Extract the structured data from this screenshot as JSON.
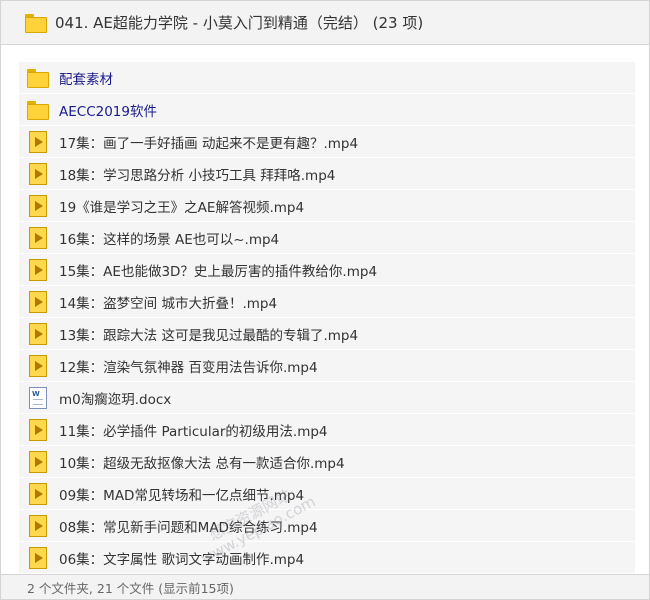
{
  "header": {
    "title": "041. AE超能力学院 - 小莫入门到精通（完结） (23 项)"
  },
  "items": [
    {
      "type": "folder",
      "label": "配套素材"
    },
    {
      "type": "folder",
      "label": "AECC2019软件"
    },
    {
      "type": "media",
      "label": "17集：画了一手好插画 动起来不是更有趣？.mp4"
    },
    {
      "type": "media",
      "label": "18集：学习思路分析 小技巧工具 拜拜咯.mp4"
    },
    {
      "type": "media",
      "label": "19《谁是学习之王》之AE解答视频.mp4"
    },
    {
      "type": "media",
      "label": "16集：这样的场景 AE也可以~.mp4"
    },
    {
      "type": "media",
      "label": "15集：AE也能做3D？史上最厉害的插件教给你.mp4"
    },
    {
      "type": "media",
      "label": "14集：盗梦空间 城市大折叠！.mp4"
    },
    {
      "type": "media",
      "label": "13集：跟踪大法 这可是我见过最酷的专辑了.mp4"
    },
    {
      "type": "media",
      "label": "12集：渲染气氛神器 百变用法告诉你.mp4"
    },
    {
      "type": "doc",
      "label": "m0淘瘸迩玥.docx"
    },
    {
      "type": "media",
      "label": "11集：必学插件 Particular的初级用法.mp4"
    },
    {
      "type": "media",
      "label": "10集：超级无敌抠像大法 总有一款适合你.mp4"
    },
    {
      "type": "media",
      "label": "09集：MAD常见转场和一亿点细节.mp4"
    },
    {
      "type": "media",
      "label": "08集：常见新手问题和MAD综合练习.mp4"
    },
    {
      "type": "media",
      "label": "06集：文字属性 歌词文字动画制作.mp4"
    }
  ],
  "watermark": {
    "line1": "想宝资源网站",
    "line2": "www.yepiao.com"
  },
  "status": {
    "text": "2 个文件夹, 21 个文件 (显示前15项)"
  }
}
